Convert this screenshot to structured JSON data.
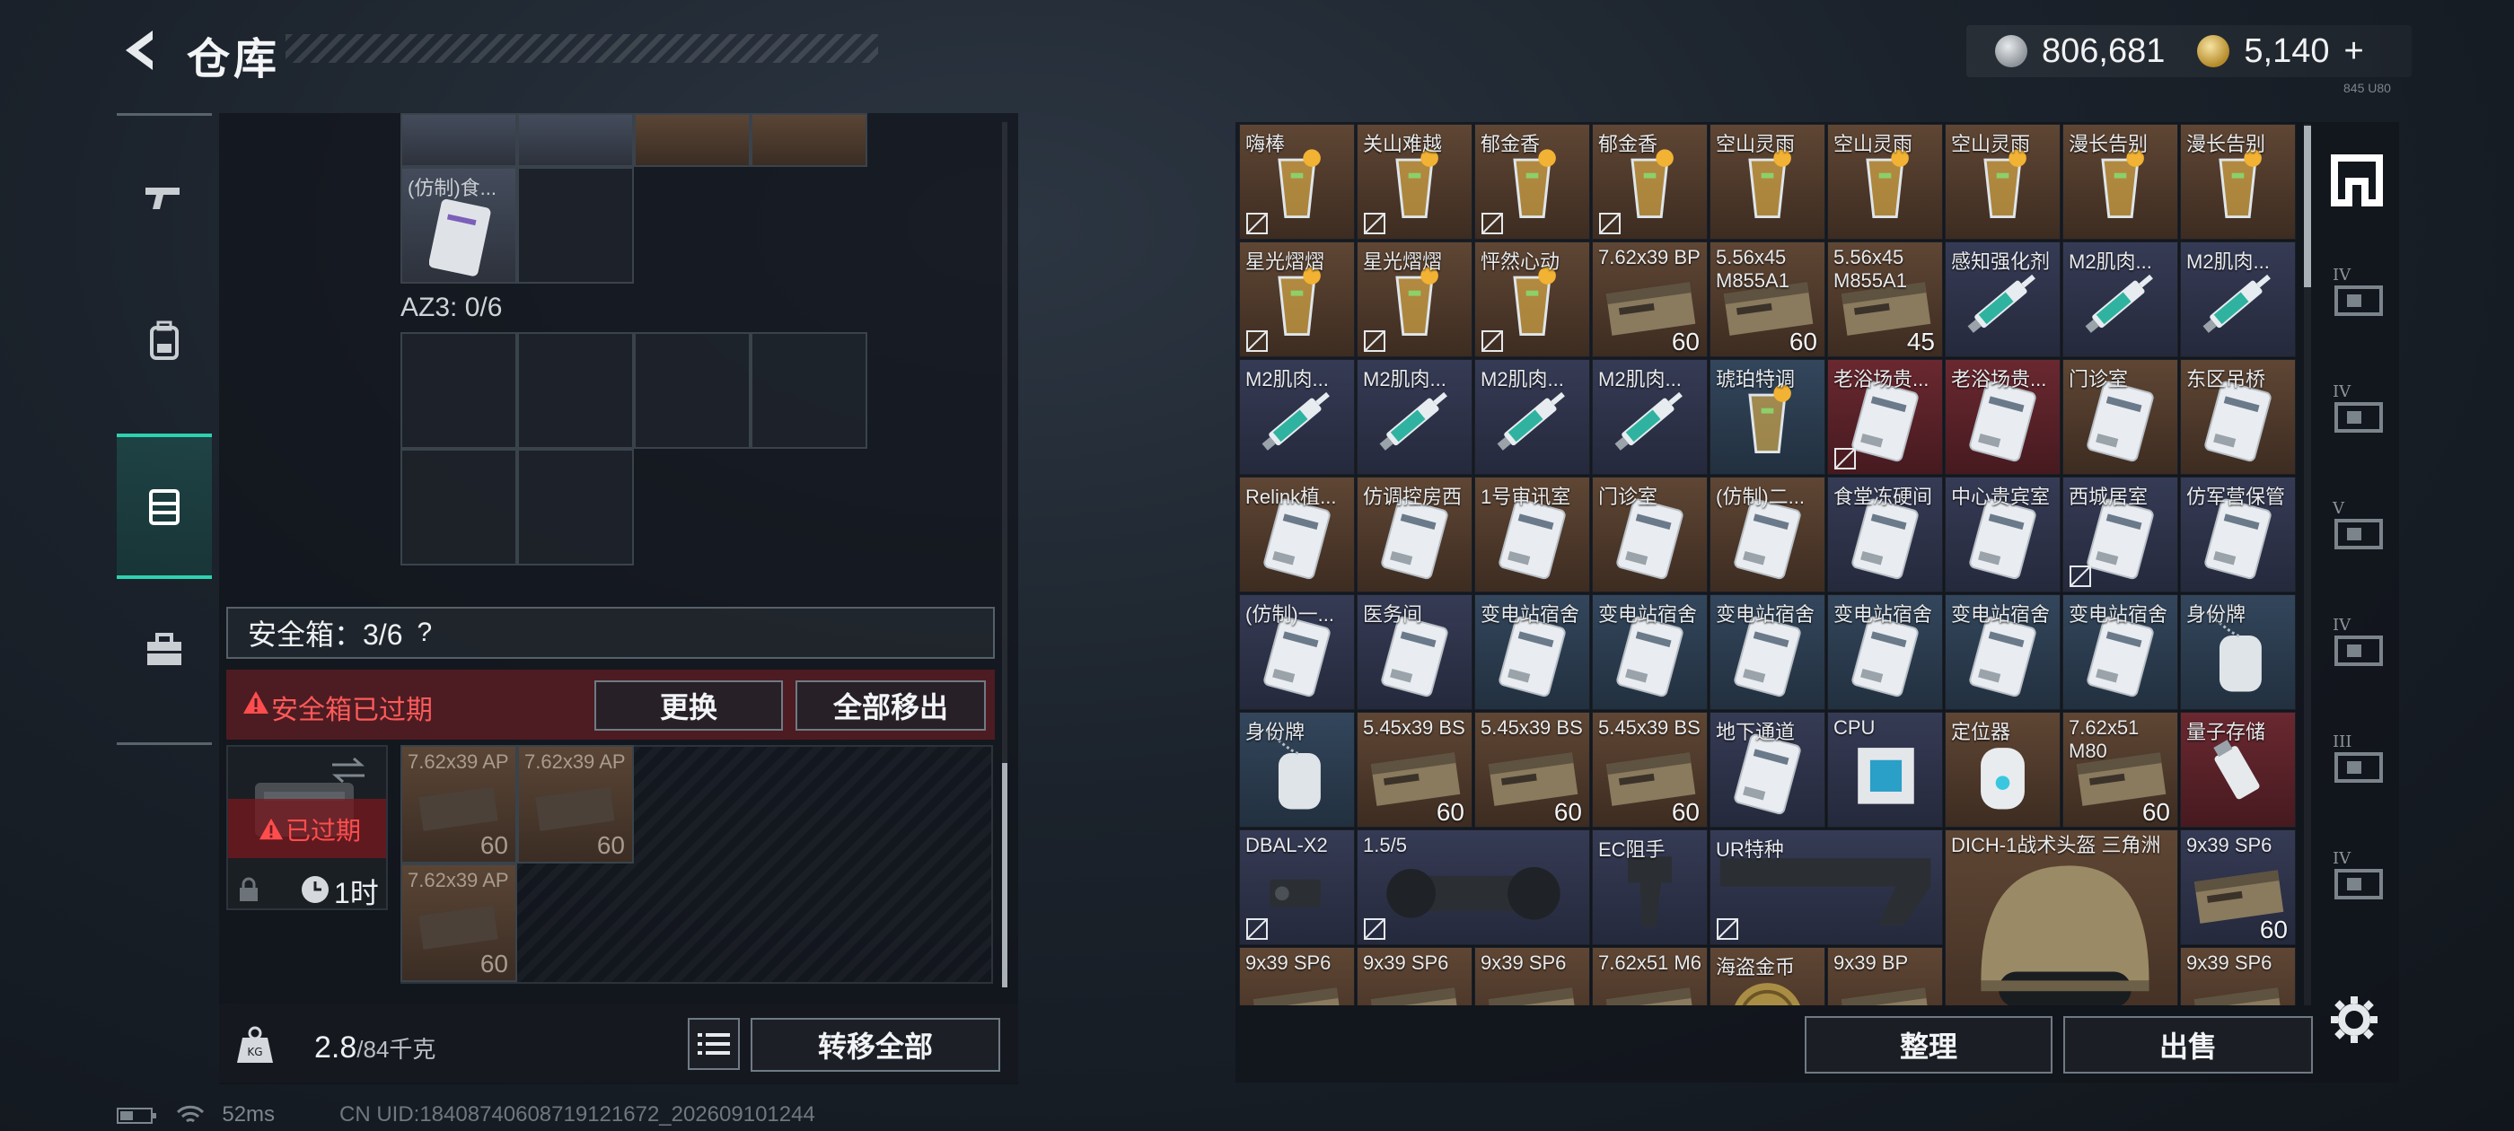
{
  "header": {
    "title": "仓库",
    "back_icon": "chevron-left-icon",
    "currency_silver": "806,681",
    "currency_gold": "5,140",
    "plus_label": "+",
    "version": "845 U80"
  },
  "sidebar": {
    "items": [
      {
        "icon": "gun-icon",
        "active": false
      },
      {
        "icon": "backpack-icon",
        "active": false
      },
      {
        "icon": "vest-icon",
        "active": true
      },
      {
        "icon": "toolbox-icon",
        "active": false
      }
    ]
  },
  "left": {
    "top_items": [
      {
        "label": "(仿制)食..."
      }
    ],
    "az3_label": "AZ3: 0/6",
    "safe_title": "安全箱：3/6",
    "safe_help": "?",
    "safe_expired_text": "安全箱已过期",
    "replace_button": "更换",
    "move_all_out_button": "全部移出",
    "case_expired": "已过期",
    "case_timer": "1时",
    "safe_items": [
      {
        "label": "7.62x39 AP",
        "count": "60"
      },
      {
        "label": "7.62x39 AP",
        "count": "60"
      },
      {
        "label": "7.62x39 AP",
        "count": "60"
      }
    ],
    "weight_current": "2.8",
    "weight_max": "/84千克",
    "transfer_all_button": "转移全部"
  },
  "grid": {
    "rows": [
      [
        {
          "label": "嗨棒",
          "bg": "brown",
          "icon": "cocktail-icon",
          "lock": true
        },
        {
          "label": "关山难越",
          "bg": "brown",
          "icon": "cocktail-icon",
          "lock": true
        },
        {
          "label": "郁金香",
          "bg": "brown",
          "icon": "cocktail-icon",
          "lock": true
        },
        {
          "label": "郁金香",
          "bg": "brown",
          "icon": "cocktail-icon",
          "lock": true
        },
        {
          "label": "空山灵雨",
          "bg": "brown",
          "icon": "cocktail-icon",
          "lock": false
        },
        {
          "label": "空山灵雨",
          "bg": "brown",
          "icon": "cocktail-icon",
          "lock": false
        },
        {
          "label": "空山灵雨",
          "bg": "brown",
          "icon": "cocktail-icon",
          "lock": false
        },
        {
          "label": "漫长告别",
          "bg": "brown",
          "icon": "cocktail-icon",
          "lock": false
        },
        {
          "label": "漫长告别",
          "bg": "brown",
          "icon": "cocktail-icon",
          "lock": false
        }
      ],
      [
        {
          "label": "星光熠熠",
          "bg": "brown",
          "icon": "cocktail-icon",
          "lock": true
        },
        {
          "label": "星光熠熠",
          "bg": "brown",
          "icon": "cocktail-icon",
          "lock": true
        },
        {
          "label": "怦然心动",
          "bg": "brown",
          "icon": "cocktail-icon",
          "lock": true
        },
        {
          "label": "7.62x39 BP",
          "bg": "brown",
          "icon": "ammo-box-icon",
          "count": "60",
          "lock": false
        },
        {
          "label": "5.56x45 M855A1",
          "bg": "brown",
          "icon": "ammo-box-icon",
          "count": "60",
          "lock": false
        },
        {
          "label": "5.56x45 M855A1",
          "bg": "brown",
          "icon": "ammo-box-icon",
          "count": "45",
          "lock": false
        },
        {
          "label": "感知强化剂",
          "bg": "navy",
          "icon": "syringe-icon",
          "lock": false
        },
        {
          "label": "M2肌肉...",
          "bg": "navy",
          "icon": "syringe-icon",
          "lock": false
        },
        {
          "label": "M2肌肉...",
          "bg": "navy",
          "icon": "syringe-icon",
          "lock": false
        }
      ],
      [
        {
          "label": "M2肌肉...",
          "bg": "navy",
          "icon": "syringe-icon",
          "lock": false
        },
        {
          "label": "M2肌肉...",
          "bg": "navy",
          "icon": "syringe-icon",
          "lock": false
        },
        {
          "label": "M2肌肉...",
          "bg": "navy",
          "icon": "syringe-icon",
          "lock": false
        },
        {
          "label": "M2肌肉...",
          "bg": "navy",
          "icon": "syringe-icon",
          "lock": false
        },
        {
          "label": "琥珀特调",
          "bg": "blue",
          "icon": "cocktail-icon",
          "lock": false
        },
        {
          "label": "老浴场贵...",
          "bg": "red",
          "icon": "keycard-icon",
          "lock": true
        },
        {
          "label": "老浴场贵...",
          "bg": "red",
          "icon": "keycard-icon",
          "lock": false
        },
        {
          "label": "门诊室",
          "bg": "brown",
          "icon": "keycard-icon",
          "lock": false
        },
        {
          "label": "东区吊桥",
          "bg": "brown",
          "icon": "keycard-icon",
          "lock": false
        }
      ],
      [
        {
          "label": "Relink植...",
          "bg": "brown",
          "icon": "keycard-icon",
          "lock": false
        },
        {
          "label": "仿调控房西",
          "bg": "brown",
          "icon": "keycard-icon",
          "lock": false
        },
        {
          "label": "1号审讯室",
          "bg": "brown",
          "icon": "keycard-icon",
          "lock": false
        },
        {
          "label": "门诊室",
          "bg": "brown",
          "icon": "keycard-icon",
          "lock": false
        },
        {
          "label": "(仿制)二...",
          "bg": "brown",
          "icon": "keycard-icon",
          "lock": false
        },
        {
          "label": "食堂冻硬间",
          "bg": "navy",
          "icon": "keycard-icon",
          "lock": false
        },
        {
          "label": "中心贵宾室",
          "bg": "navy",
          "icon": "keycard-icon",
          "lock": false
        },
        {
          "label": "西城居室",
          "bg": "navy",
          "icon": "keycard-icon",
          "lock": true
        },
        {
          "label": "仿军营保管",
          "bg": "navy",
          "icon": "keycard-icon",
          "lock": false
        }
      ],
      [
        {
          "label": "(仿制)一...",
          "bg": "navy",
          "icon": "keycard-icon",
          "lock": false
        },
        {
          "label": "医务间",
          "bg": "navy",
          "icon": "keycard-icon",
          "lock": false
        },
        {
          "label": "变电站宿舍",
          "bg": "blue",
          "icon": "keycard-icon",
          "lock": false
        },
        {
          "label": "变电站宿舍",
          "bg": "blue",
          "icon": "keycard-icon",
          "lock": false
        },
        {
          "label": "变电站宿舍",
          "bg": "blue",
          "icon": "keycard-icon",
          "lock": false
        },
        {
          "label": "变电站宿舍",
          "bg": "blue",
          "icon": "keycard-icon",
          "lock": false
        },
        {
          "label": "变电站宿舍",
          "bg": "blue",
          "icon": "keycard-icon",
          "lock": false
        },
        {
          "label": "变电站宿舍",
          "bg": "blue",
          "icon": "keycard-icon",
          "lock": false
        },
        {
          "label": "身份牌",
          "bg": "blue",
          "icon": "dogtag-icon",
          "lock": false
        }
      ],
      [
        {
          "label": "身份牌",
          "bg": "blue",
          "icon": "dogtag-icon",
          "lock": false
        },
        {
          "label": "5.45x39 BS",
          "bg": "brown",
          "icon": "ammo-box-icon",
          "count": "60",
          "lock": false
        },
        {
          "label": "5.45x39 BS",
          "bg": "brown",
          "icon": "ammo-box-icon",
          "count": "60",
          "lock": false
        },
        {
          "label": "5.45x39 BS",
          "bg": "brown",
          "icon": "ammo-box-icon",
          "count": "60",
          "lock": false
        },
        {
          "label": "地下通道",
          "bg": "navy",
          "icon": "keycard-icon",
          "lock": false
        },
        {
          "label": "CPU",
          "bg": "navy",
          "icon": "cpu-icon",
          "lock": false
        },
        {
          "label": "定位器",
          "bg": "brown",
          "icon": "locator-icon",
          "lock": false
        },
        {
          "label": "7.62x51 M80",
          "bg": "brown",
          "icon": "ammo-box-icon",
          "count": "60",
          "lock": false
        },
        {
          "label": "量子存储",
          "bg": "red",
          "icon": "usb-icon",
          "lock": false
        }
      ],
      [
        {
          "label": "DBAL-X2",
          "bg": "navy",
          "icon": "laser-icon",
          "lock": true
        },
        {
          "label": "1.5/5",
          "bg": "navy",
          "icon": "scope-icon",
          "lock": true,
          "span": 2
        },
        {
          "label": "EC阻手",
          "bg": "navy",
          "icon": "grip-icon",
          "lock": false
        },
        {
          "label": "UR特种",
          "bg": "navy",
          "icon": "stock-icon",
          "lock": true,
          "span": 2
        },
        {
          "label": "DICH-1战术头盔 三角洲",
          "bg": "brown",
          "icon": "helmet-icon",
          "lock": false,
          "span": 2,
          "rowspan": 2
        },
        {
          "label": "9x39 SP6",
          "bg": "navy",
          "icon": "ammo-box-icon",
          "count": "60",
          "lock": false
        }
      ],
      [
        {
          "label": "9x39 SP6",
          "bg": "brown",
          "icon": "ammo-box-icon",
          "lock": false
        },
        {
          "label": "9x39 SP6",
          "bg": "brown",
          "icon": "ammo-box-icon",
          "lock": false
        },
        {
          "label": "9x39 SP6",
          "bg": "brown",
          "icon": "ammo-box-icon",
          "lock": false
        },
        {
          "label": "7.62x51 M6",
          "bg": "brown",
          "icon": "ammo-box-icon",
          "lock": false
        },
        {
          "label": "海盗金币",
          "bg": "brown",
          "icon": "coin-icon",
          "lock": false
        },
        {
          "label": "9x39 BP",
          "bg": "brown",
          "icon": "ammo-box-icon",
          "lock": false
        },
        {
          "label": "9x39 SP6",
          "bg": "brown",
          "icon": "ammo-box-icon",
          "lock": false
        }
      ]
    ]
  },
  "right_bottom": {
    "sort_button": "整理",
    "sell_button": "出售"
  },
  "right_icons": [
    {
      "icon": "stash-icon",
      "label": ""
    },
    {
      "icon": "case-iv-icon",
      "label": "IV"
    },
    {
      "icon": "case-iv-icon",
      "label": "IV"
    },
    {
      "icon": "case-v-icon",
      "label": "V"
    },
    {
      "icon": "case-iv-icon",
      "label": "IV"
    },
    {
      "icon": "case-iii-icon",
      "label": "III"
    },
    {
      "icon": "case-iv-icon",
      "label": "IV"
    }
  ],
  "settings_icon": "gear-icon",
  "footer": {
    "ping": "52ms",
    "uid": "CN UID:18408740608719121672_202609101244"
  },
  "colors": {
    "accent": "#2ed1b0",
    "warning": "#ff4d4d"
  }
}
